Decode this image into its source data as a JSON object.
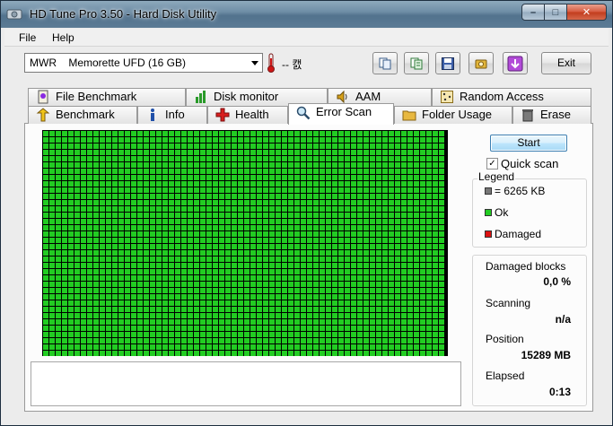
{
  "window": {
    "title": "HD Tune Pro 3.50 - Hard Disk Utility",
    "buttons": {
      "minimize": "–",
      "maximize": "□",
      "close": "✕"
    }
  },
  "menu": {
    "file": "File",
    "help": "Help"
  },
  "toolbar": {
    "drive": "MWR    Memorette UFD (16 GB)",
    "temperature": "-- 캜",
    "exit_label": "Exit",
    "icons": [
      "copy-icon",
      "copy-text-icon",
      "save-icon",
      "options-icon",
      "download-icon"
    ]
  },
  "tabs": {
    "top": [
      "File Benchmark",
      "Disk monitor",
      "AAM",
      "Random Access"
    ],
    "bottom": [
      "Benchmark",
      "Info",
      "Health",
      "Error Scan",
      "Folder Usage",
      "Erase"
    ],
    "active": "Error Scan"
  },
  "scan": {
    "start_label": "Start",
    "quick_scan_label": "Quick scan",
    "quick_scan_checked": true,
    "blocks_ok_fraction": 1.0
  },
  "legend": {
    "title": "Legend",
    "block_size": "= 6265 KB",
    "ok": "Ok",
    "damaged": "Damaged",
    "colors": {
      "ok": "#22cc22",
      "damaged": "#dd1111",
      "block": "#777777"
    }
  },
  "stats": {
    "damaged_blocks_label": "Damaged blocks",
    "damaged_blocks_value": "0,0 %",
    "scanning_label": "Scanning",
    "scanning_value": "n/a",
    "position_label": "Position",
    "position_value": "15289 MB",
    "elapsed_label": "Elapsed",
    "elapsed_value": "0:13"
  }
}
